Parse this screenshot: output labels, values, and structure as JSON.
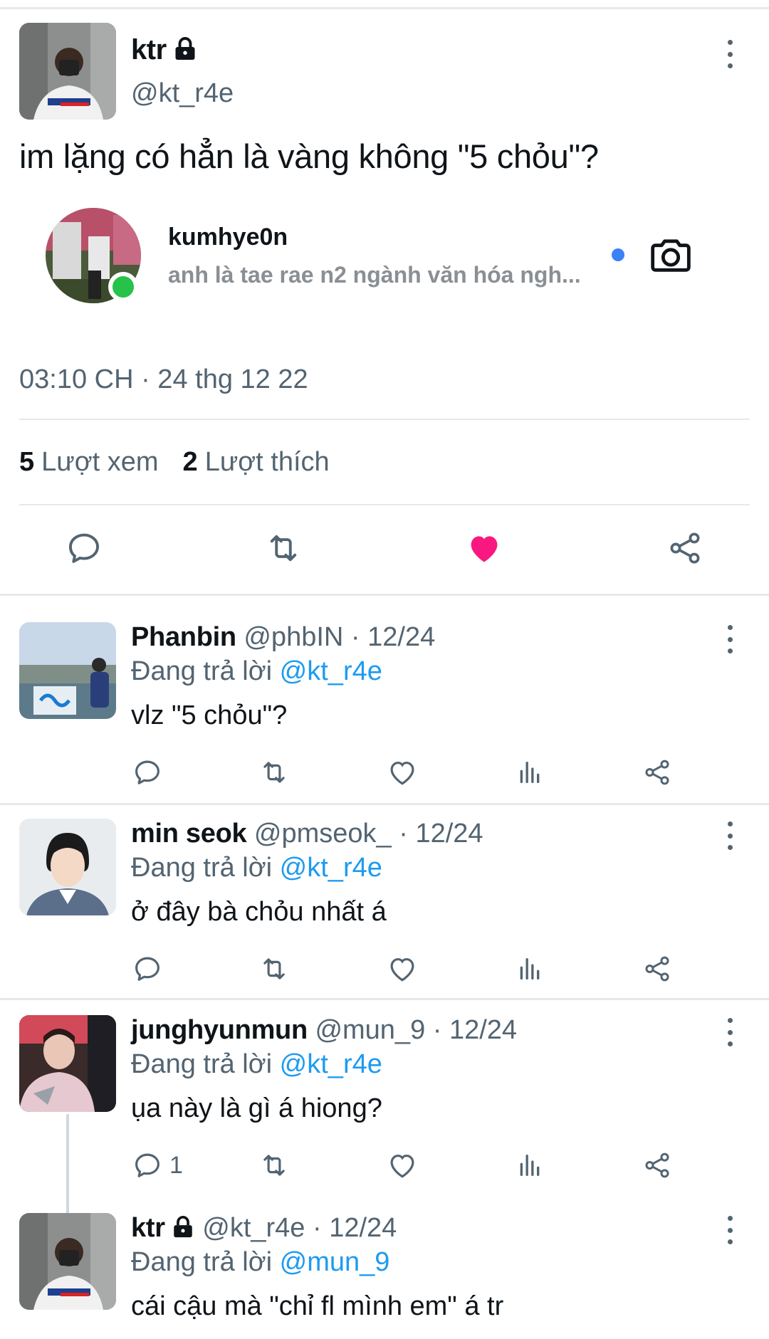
{
  "main_tweet": {
    "name": "ktr",
    "handle": "@kt_r4e",
    "text": "im lặng có hẳn là vàng không \"5 chỏu\"?",
    "timestamp": "03:10 CH · 24 thg 12 22",
    "views_count": "5",
    "views_label": "Lượt xem",
    "likes_count": "2",
    "likes_label": "Lượt thích",
    "liked": true
  },
  "dm_preview": {
    "name": "kumhye0n",
    "message": "anh là tae rae n2 ngành văn hóa ngh...",
    "online": true,
    "unread": true
  },
  "colors": {
    "accent": "#1d9bf0",
    "like": "#f91880",
    "muted": "#536471",
    "online": "#26c24a"
  },
  "replies": [
    {
      "name": "Phanbin",
      "handle": "@phbIN",
      "date": "· 12/24",
      "replying_prefix": "Đang trả lời",
      "replying_to": "@kt_r4e",
      "text": "vlz \"5 chỏu\"?",
      "reply_count": ""
    },
    {
      "name": "min seok",
      "handle": "@pmseok_",
      "date": "· 12/24",
      "replying_prefix": "Đang trả lời",
      "replying_to": "@kt_r4e",
      "text": "ở đây bà chỏu nhất á",
      "reply_count": ""
    },
    {
      "name": "junghyunmun",
      "handle": "@mun_9",
      "date": "· 12/24",
      "replying_prefix": "Đang trả lời",
      "replying_to": "@kt_r4e",
      "text": "ụa này là gì á hiong?",
      "reply_count": "1"
    },
    {
      "name": "ktr",
      "handle": "@kt_r4e",
      "date": "· 12/24",
      "replying_prefix": "Đang trả lời",
      "replying_to": "@mun_9",
      "text": "cái cậu mà \"chỉ fl mình em\" á tr",
      "locked": true
    }
  ]
}
